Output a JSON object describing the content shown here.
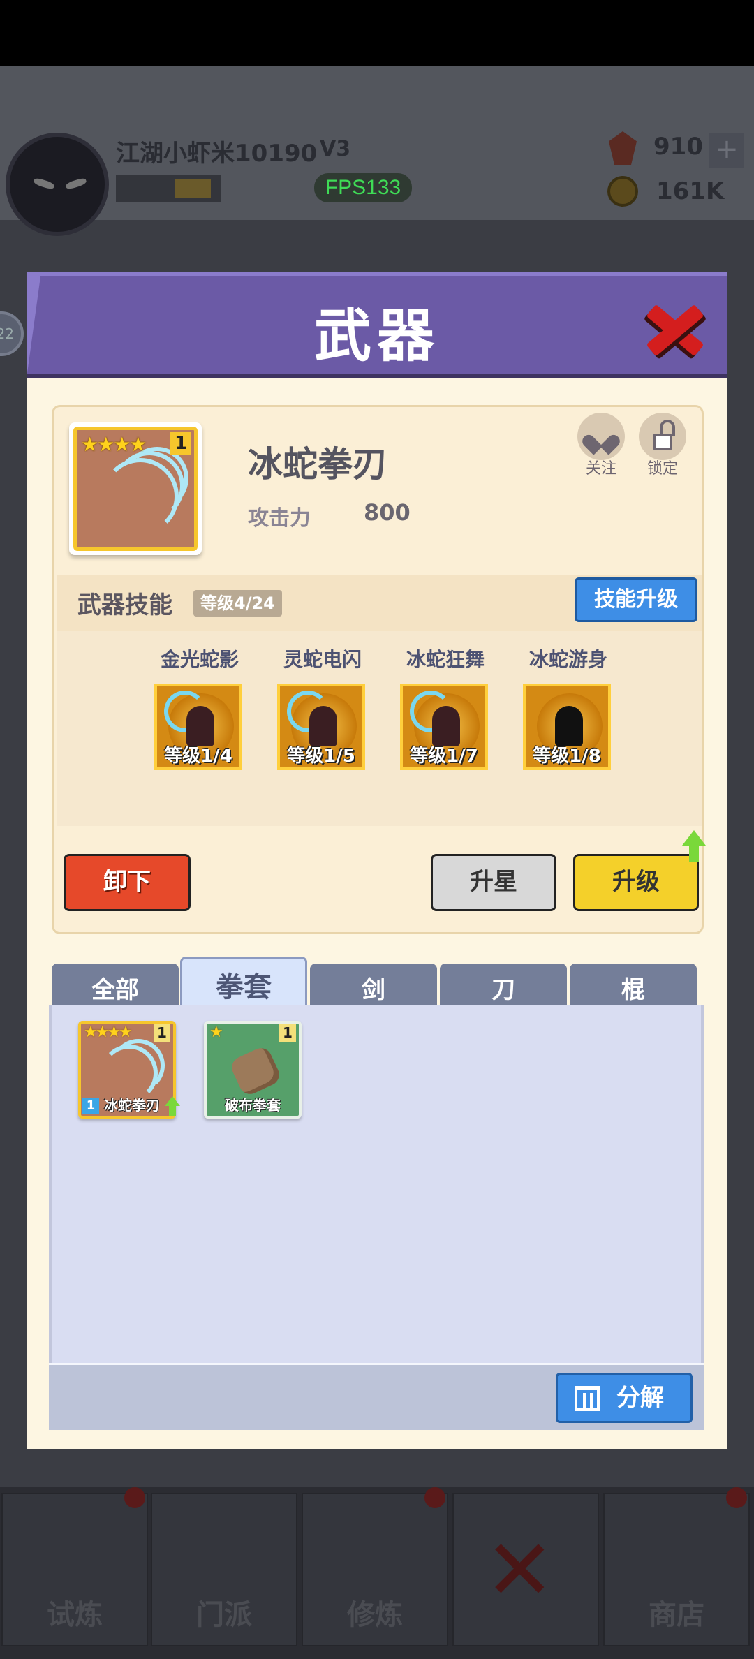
{
  "hud": {
    "player_name": "江湖小虾米10190",
    "vip": "V3",
    "fps": "FPS133",
    "gems": "910",
    "coins": "161K",
    "plus": "+",
    "side_badge": "22"
  },
  "bottom_nav": [
    {
      "label": "试炼"
    },
    {
      "label": "门派"
    },
    {
      "label": "修炼"
    },
    {
      "label": ""
    },
    {
      "label": "商店"
    }
  ],
  "modal": {
    "title": "武器",
    "weapon": {
      "name": "冰蛇拳刃",
      "stars": "★★★★",
      "count": "1",
      "attack_label": "攻击力",
      "attack_value": "800",
      "follow_label": "关注",
      "lock_label": "锁定"
    },
    "skills": {
      "title": "武器技能",
      "level": "等级4/24",
      "upgrade_button": "技能升级",
      "items": [
        {
          "name": "金光蛇影",
          "level": "等级1/4"
        },
        {
          "name": "灵蛇电闪",
          "level": "等级1/5"
        },
        {
          "name": "冰蛇狂舞",
          "level": "等级1/7"
        },
        {
          "name": "冰蛇游身",
          "level": "等级1/8"
        }
      ]
    },
    "buttons": {
      "unequip": "卸下",
      "star_up": "升星",
      "upgrade": "升级"
    },
    "tabs": [
      "全部",
      "拳套",
      "剑",
      "刀",
      "棍"
    ],
    "active_tab": "拳套",
    "inventory": [
      {
        "name": "冰蛇拳刃",
        "stars": "★★★★",
        "count": "1",
        "equipped_badge": "1",
        "color": "#b87a5e",
        "border": "#f6c62c"
      },
      {
        "name": "破布拳套",
        "stars": "★",
        "count": "1",
        "color": "#56a06a",
        "border": "#e8f0e8"
      }
    ],
    "decompose_button": "分解"
  }
}
